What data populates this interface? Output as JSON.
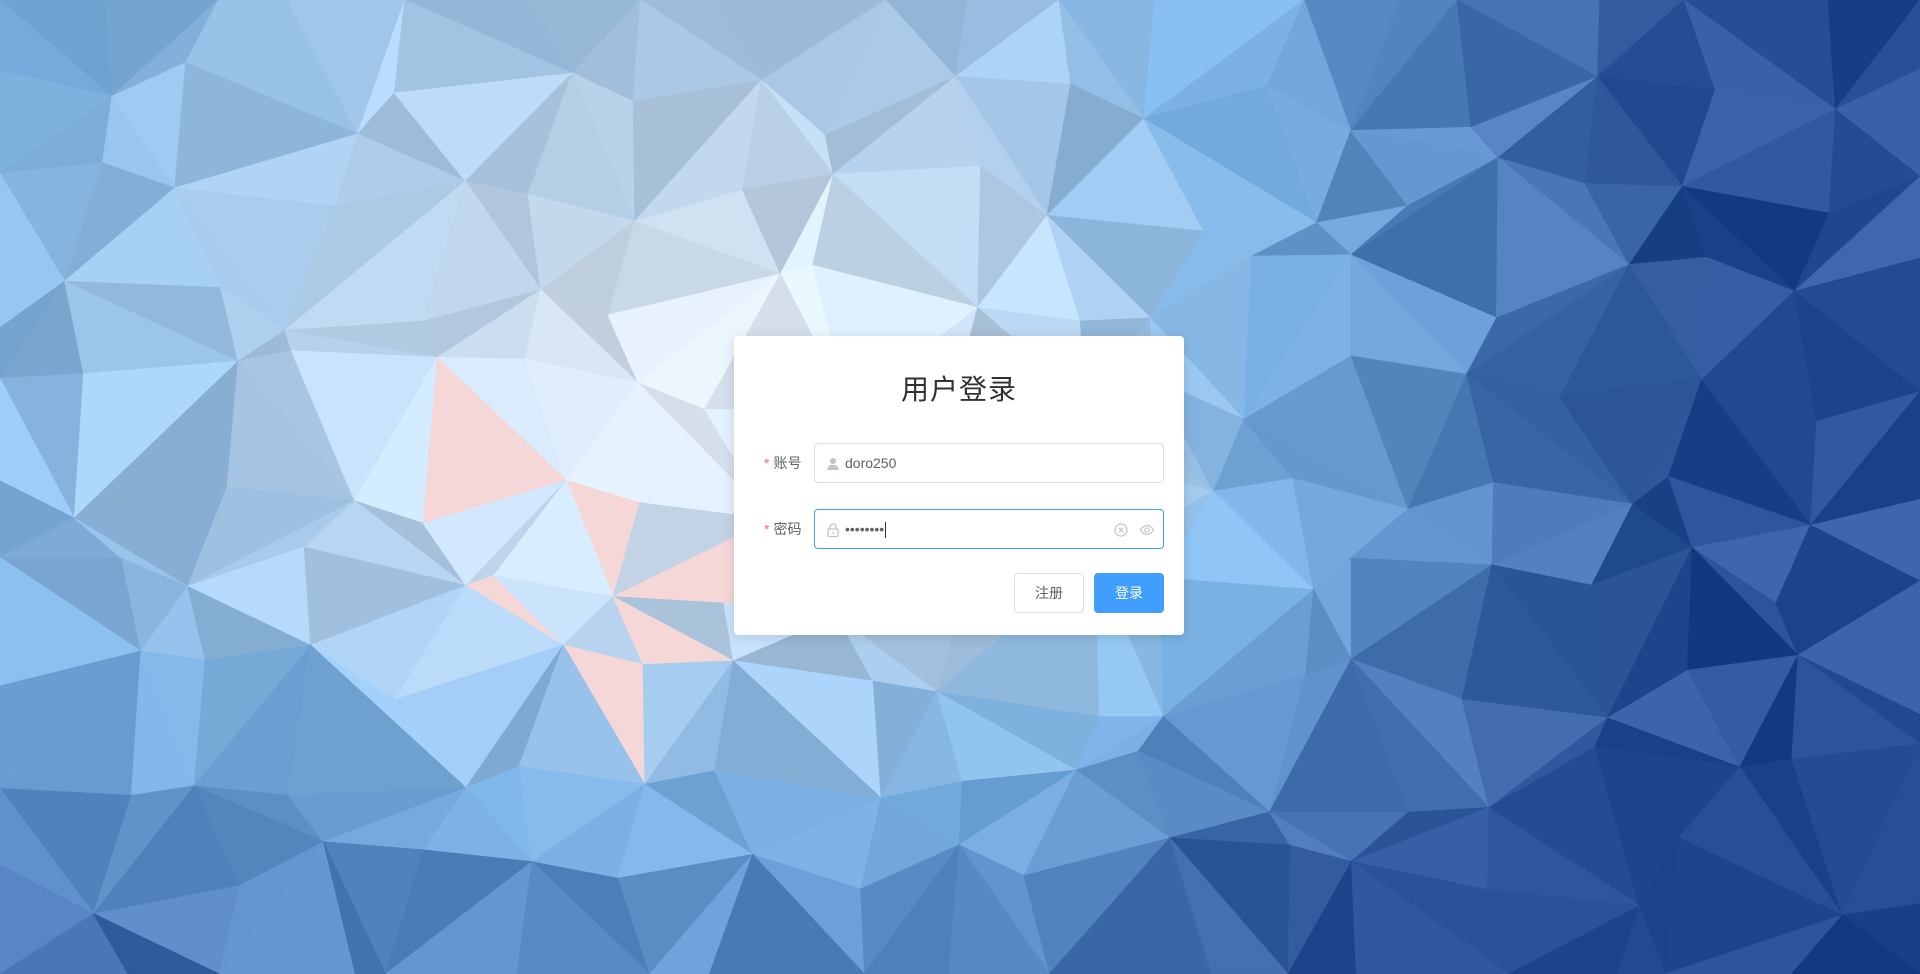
{
  "login": {
    "title": "用户登录",
    "account": {
      "label": "账号",
      "required_mark": "*",
      "value": "doro250"
    },
    "password": {
      "label": "密码",
      "required_mark": "*",
      "masked_value": "••••••••"
    },
    "register_label": "注册",
    "submit_label": "登录"
  },
  "icons": {
    "account_prefix": "user-icon",
    "password_prefix": "lock-icon",
    "password_clear": "circle-close-icon",
    "password_toggle": "eye-icon"
  },
  "colors": {
    "primary": "#409eff",
    "required": "#f56c6c",
    "text": "#606266",
    "title": "#303133",
    "border": "#dcdfe6"
  }
}
